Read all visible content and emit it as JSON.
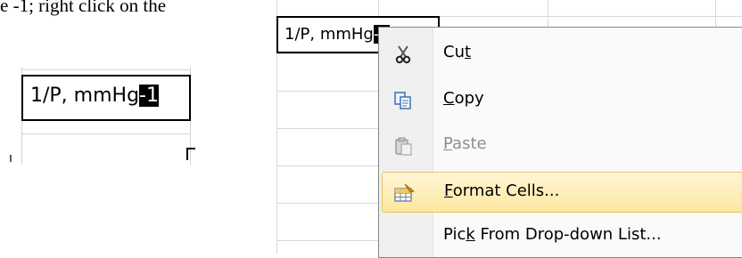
{
  "document": {
    "text": "e -1; right click on the"
  },
  "left_cell": {
    "text_before": "1/P, mmHg",
    "text_selected": "-1",
    "tick": "ı"
  },
  "right_cell": {
    "text_before": "1/P, mm",
    "text_partial": "Hg",
    "text_selected": "-1"
  },
  "context_menu": {
    "items": [
      {
        "pre": "Cu",
        "ul": "t",
        "post": "",
        "icon": "scissors-icon",
        "enabled": true,
        "highlighted": false
      },
      {
        "pre": "",
        "ul": "C",
        "post": "opy",
        "icon": "copy-icon",
        "enabled": true,
        "highlighted": false
      },
      {
        "pre": "",
        "ul": "P",
        "post": "aste",
        "icon": "paste-icon",
        "enabled": false,
        "highlighted": false
      },
      {
        "pre": "",
        "ul": "F",
        "post": "ormat Cells...",
        "icon": "format-cells-icon",
        "enabled": true,
        "highlighted": true
      },
      {
        "pre": "Pic",
        "ul": "k",
        "post": " From Drop-down List...",
        "icon": "",
        "enabled": true,
        "highlighted": false
      }
    ]
  },
  "colors": {
    "highlight": "#fde7a0",
    "highlight_border": "#e5c365",
    "disabled_text": "#8d8d8d"
  }
}
